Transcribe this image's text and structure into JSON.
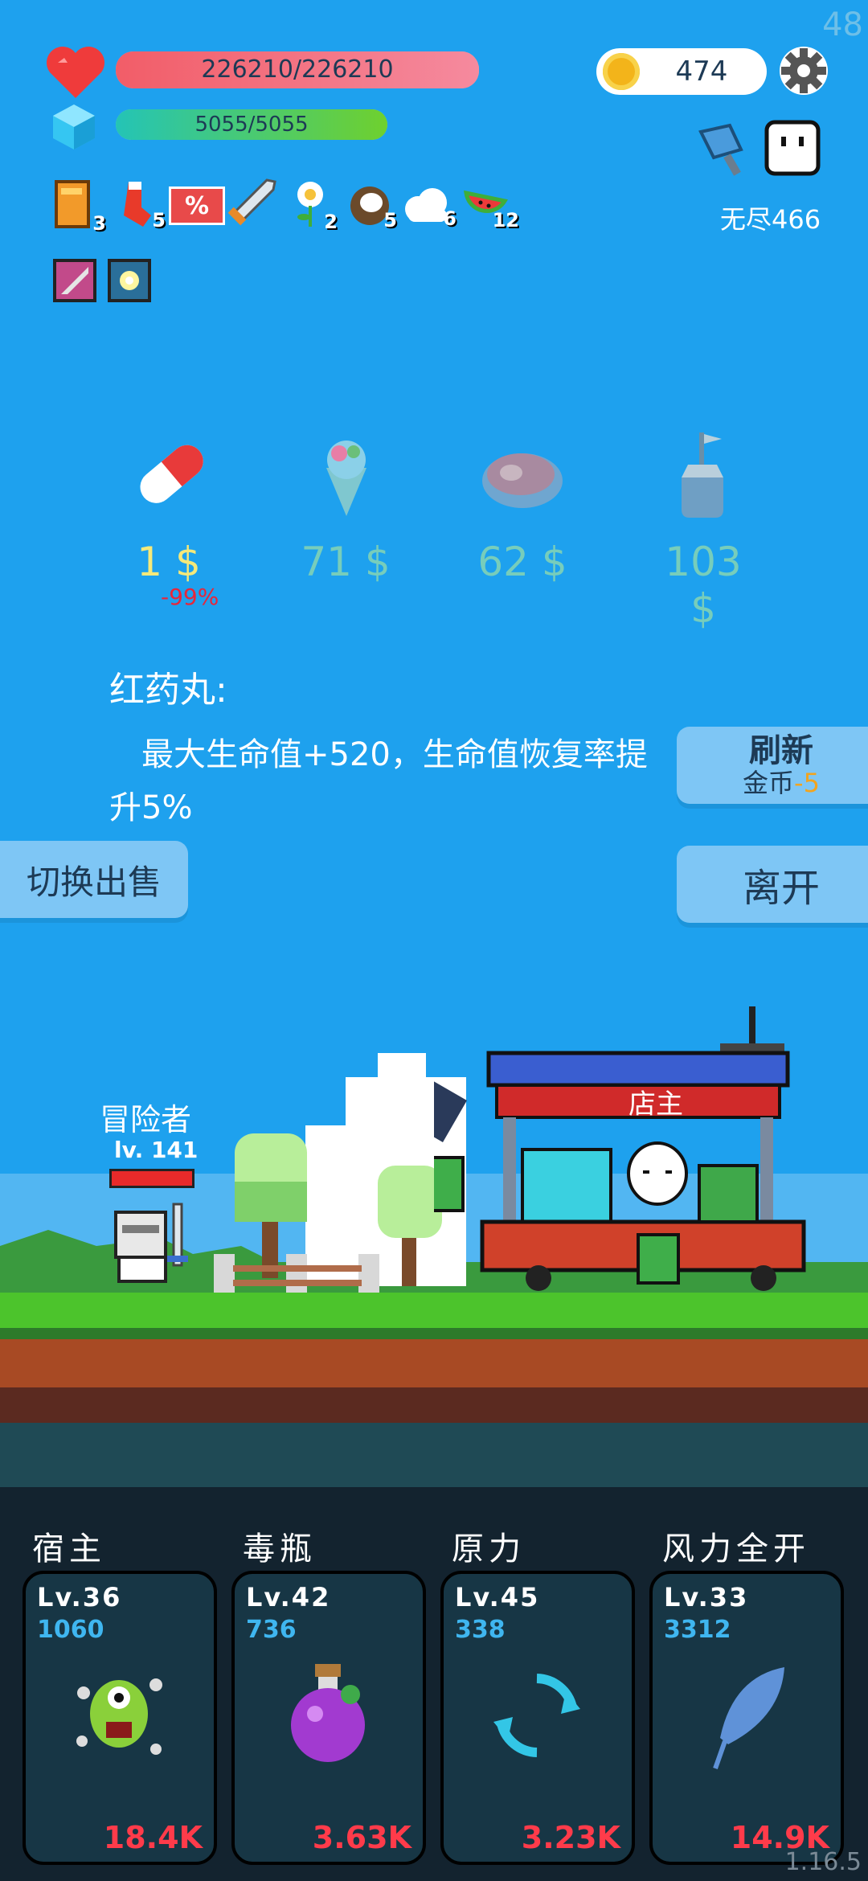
{
  "fps": "48",
  "hp": {
    "text": "226210/226210",
    "ratio": 1.0,
    "color": "#f5697a"
  },
  "mana": {
    "text": "5055/5055",
    "ratio": 1.0,
    "color": "#3bc97a"
  },
  "gold": "474",
  "endless": "无尽466",
  "items": [
    {
      "icon": "book-icon",
      "count": "3"
    },
    {
      "icon": "sock-icon",
      "count": "5"
    },
    {
      "icon": "percent-icon",
      "label": "%",
      "count": ""
    },
    {
      "icon": "sword-icon",
      "count": ""
    },
    {
      "icon": "flower-icon",
      "count": "2"
    },
    {
      "icon": "coconut-icon",
      "count": "5"
    },
    {
      "icon": "cloud-icon",
      "count": "6"
    },
    {
      "icon": "watermelon-icon",
      "count": "12"
    }
  ],
  "buffs": [
    "mirror-icon",
    "light-icon"
  ],
  "shop": [
    {
      "name": "red-pill",
      "price": "1 $",
      "discount": "-99%"
    },
    {
      "name": "ice-cream",
      "price": "71 $"
    },
    {
      "name": "meat",
      "price": "62 $"
    },
    {
      "name": "flask",
      "price": "103 $"
    }
  ],
  "desc_title": "红药丸:",
  "desc_body_1": "最大生命值+520，生命值恢复率提",
  "desc_body_2": "升5%",
  "refresh": {
    "label": "刷新",
    "cost_label": "金币",
    "cost": "-5"
  },
  "switch_sell": "切换出售",
  "leave": "离开",
  "player": {
    "name": "冒险者",
    "level": "lv. 141"
  },
  "shopkeeper": "店主",
  "skills": [
    {
      "title": "宿主",
      "lv": "Lv.36",
      "num": "1060",
      "cost": "18.4K",
      "icon": "monster-icon"
    },
    {
      "title": "毒瓶",
      "lv": "Lv.42",
      "num": "736",
      "cost": "3.63K",
      "icon": "potion-icon"
    },
    {
      "title": "原力",
      "lv": "Lv.45",
      "num": "338",
      "cost": "3.23K",
      "icon": "refresh-icon"
    },
    {
      "title": "风力全开",
      "lv": "Lv.33",
      "num": "3312",
      "cost": "14.9K",
      "icon": "feather-icon"
    }
  ],
  "version": "1.16.5"
}
